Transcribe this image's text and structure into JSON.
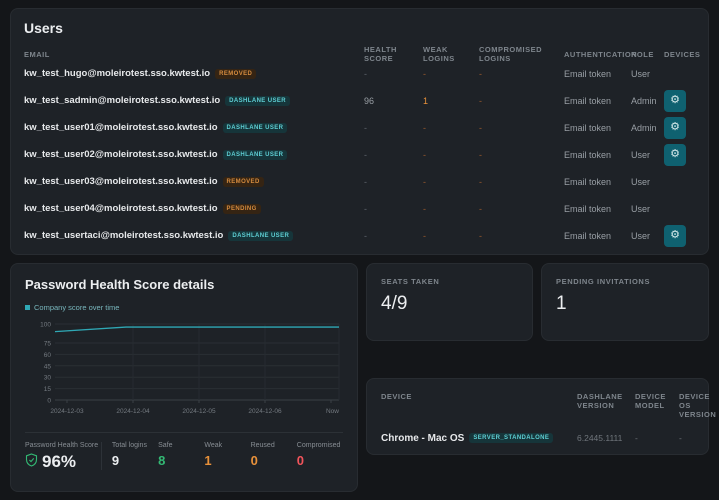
{
  "colors": {
    "accent_teal": "#2fa8b5",
    "teal_button": "#0f6170",
    "green": "#33b974",
    "orange": "#e8913a",
    "red": "#f2545b",
    "badge_orange_text": "#d68c3f",
    "badge_teal_text": "#5ecfd4"
  },
  "users_panel": {
    "title": "Users",
    "columns": [
      "EMAIL",
      "HEALTH SCORE",
      "WEAK LOGINS",
      "COMPROMISED LOGINS",
      "AUTHENTICATION",
      "ROLE",
      "DEVICES"
    ],
    "rows": [
      {
        "email": "kw_test_hugo@moleirotest.sso.kwtest.io",
        "badge": "REMOVED",
        "badge_type": "orange",
        "health_score": "-",
        "weak_logins": "-",
        "compromised_logins": "-",
        "authentication": "Email token",
        "role": "User",
        "has_devices_button": false
      },
      {
        "email": "kw_test_sadmin@moleirotest.sso.kwtest.io",
        "badge": "DASHLANE USER",
        "badge_type": "teal",
        "health_score": "96",
        "weak_logins": "1",
        "compromised_logins": "-",
        "authentication": "Email token",
        "role": "Admin",
        "has_devices_button": true
      },
      {
        "email": "kw_test_user01@moleirotest.sso.kwtest.io",
        "badge": "DASHLANE USER",
        "badge_type": "teal",
        "health_score": "-",
        "weak_logins": "-",
        "compromised_logins": "-",
        "authentication": "Email token",
        "role": "Admin",
        "has_devices_button": true
      },
      {
        "email": "kw_test_user02@moleirotest.sso.kwtest.io",
        "badge": "DASHLANE USER",
        "badge_type": "teal",
        "health_score": "-",
        "weak_logins": "-",
        "compromised_logins": "-",
        "authentication": "Email token",
        "role": "User",
        "has_devices_button": true
      },
      {
        "email": "kw_test_user03@moleirotest.sso.kwtest.io",
        "badge": "REMOVED",
        "badge_type": "orange",
        "health_score": "-",
        "weak_logins": "-",
        "compromised_logins": "-",
        "authentication": "Email token",
        "role": "User",
        "has_devices_button": false
      },
      {
        "email": "kw_test_user04@moleirotest.sso.kwtest.io",
        "badge": "PENDING",
        "badge_type": "orange",
        "health_score": "-",
        "weak_logins": "-",
        "compromised_logins": "-",
        "authentication": "Email token",
        "role": "User",
        "has_devices_button": false
      },
      {
        "email": "kw_test_usertaci@moleirotest.sso.kwtest.io",
        "badge": "DASHLANE USER",
        "badge_type": "teal",
        "health_score": "-",
        "weak_logins": "-",
        "compromised_logins": "-",
        "authentication": "Email token",
        "role": "User",
        "has_devices_button": true
      }
    ]
  },
  "health_panel": {
    "title": "Password Health Score details",
    "legend": "Company score over time",
    "stats": [
      {
        "label": "Password Health Score",
        "value": "96%",
        "color": "white",
        "icon": "shield-check",
        "big": true,
        "divider_after": true
      },
      {
        "label": "Total logins",
        "value": "9",
        "color": "white"
      },
      {
        "label": "Safe",
        "value": "8",
        "color": "green"
      },
      {
        "label": "Weak",
        "value": "1",
        "color": "orange"
      },
      {
        "label": "Reused",
        "value": "0",
        "color": "orange"
      },
      {
        "label": "Compromised",
        "value": "0",
        "color": "red"
      }
    ]
  },
  "chart_data": {
    "type": "line",
    "title": "Company score over time",
    "x": [
      "2024-12-03",
      "2024-12-04",
      "2024-12-05",
      "2024-12-06",
      "Now"
    ],
    "series": [
      {
        "name": "Company score over time",
        "values": [
          90,
          96,
          96,
          96,
          96
        ]
      }
    ],
    "yticks": [
      0,
      15,
      30,
      45,
      60,
      75,
      100
    ],
    "ylim": [
      0,
      100
    ],
    "grid": true,
    "legend_position": "top-left",
    "line_color": "#2fa8b5"
  },
  "seats_card": {
    "label": "SEATS TAKEN",
    "value": "4/9"
  },
  "pending_card": {
    "label": "PENDING INVITATIONS",
    "value": "1"
  },
  "devices_panel": {
    "columns": [
      "DEVICE",
      "DASHLANE VERSION",
      "DEVICE MODEL",
      "DEVICE OS VERSION"
    ],
    "rows": [
      {
        "device": "Chrome - Mac OS",
        "badge": "SERVER_STANDALONE",
        "badge_type": "teal",
        "dashlane_version": "6.2445.1111",
        "device_model": "-",
        "device_os_version": "-"
      }
    ]
  }
}
